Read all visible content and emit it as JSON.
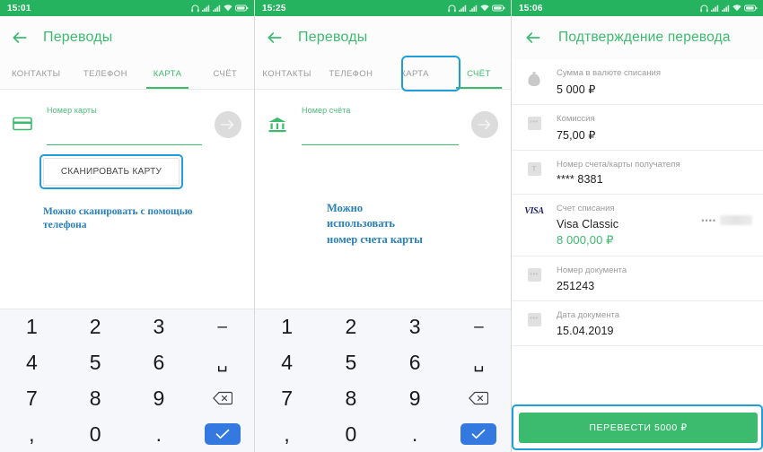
{
  "panels": [
    {
      "id": "transfers-card",
      "statusbar": {
        "time": "15:01",
        "icons": [
          "headphone-icon",
          "signal-icon",
          "signal-icon",
          "wifi-icon",
          "battery-icon"
        ]
      },
      "appbar": {
        "back": "back-arrow-icon",
        "title": "Переводы"
      },
      "tabs": [
        {
          "label": "КОНТАКТЫ",
          "active": false
        },
        {
          "label": "ТЕЛЕФОН",
          "active": false
        },
        {
          "label": "КАРТА",
          "active": true
        },
        {
          "label": "СЧЁТ",
          "active": false
        }
      ],
      "field": {
        "lead_icon": "credit-card-icon",
        "label": "Номер карты",
        "value": "",
        "placeholder": "",
        "submit_icon": "arrow-right-icon"
      },
      "scan_button": "СКАНИРОВАТЬ КАРТУ",
      "note": "Можно сканировать с помощью телефона"
    },
    {
      "id": "transfers-account",
      "statusbar": {
        "time": "15:25",
        "icons": [
          "headphone-icon",
          "signal-icon",
          "signal-icon",
          "wifi-icon",
          "battery-icon"
        ]
      },
      "appbar": {
        "back": "back-arrow-icon",
        "title": "Переводы"
      },
      "tabs": [
        {
          "label": "КОНТАКТЫ",
          "active": false
        },
        {
          "label": "ТЕЛЕФОН",
          "active": false
        },
        {
          "label": "КАРТА",
          "active": false
        },
        {
          "label": "СЧЁТ",
          "active": true
        }
      ],
      "field": {
        "lead_icon": "bank-icon",
        "label": "Номер счёта",
        "value": "",
        "placeholder": "",
        "submit_icon": "arrow-right-icon"
      },
      "note": "Можно использовать номер счета карты"
    }
  ],
  "keypad": {
    "keys": [
      {
        "label": "1",
        "name": "key-1"
      },
      {
        "label": "2",
        "name": "key-2"
      },
      {
        "label": "3",
        "name": "key-3"
      },
      {
        "label": "–",
        "name": "key-dash"
      },
      {
        "label": "4",
        "name": "key-4"
      },
      {
        "label": "5",
        "name": "key-5"
      },
      {
        "label": "6",
        "name": "key-6"
      },
      {
        "label": "␣",
        "name": "key-space"
      },
      {
        "label": "7",
        "name": "key-7"
      },
      {
        "label": "8",
        "name": "key-8"
      },
      {
        "label": "9",
        "name": "key-9"
      },
      {
        "label": "",
        "name": "key-backspace"
      },
      {
        "label": ",",
        "name": "key-comma"
      },
      {
        "label": "0",
        "name": "key-0"
      },
      {
        "label": ".",
        "name": "key-dot"
      },
      {
        "label": "",
        "name": "key-enter"
      }
    ]
  },
  "confirm": {
    "statusbar": {
      "time": "15:06"
    },
    "appbar": {
      "back": "back-arrow-icon",
      "title": "Подтверждение перевода"
    },
    "rows": [
      {
        "icon": "money-bag-icon",
        "label": "Сумма в валюте списания",
        "value": "5 000 ₽",
        "green": false
      },
      {
        "icon": "dots-square-icon",
        "label": "Комиссия",
        "value": "75,00 ₽",
        "green": false
      },
      {
        "icon": "text-square-icon",
        "label": "Номер счета/карты получателя",
        "value": "**** 8381",
        "green": false
      },
      {
        "icon": "visa-icon",
        "label": "Счет списания",
        "value": "Visa Classic",
        "value2": "8 000,00 ₽",
        "green": true,
        "trailing_dots": "••••",
        "trailing_redacted": true
      },
      {
        "icon": "dots-square-icon",
        "label": "Номер документа",
        "value": "251243",
        "green": false
      },
      {
        "icon": "dots-square-icon",
        "label": "Дата документа",
        "value": "15.04.2019",
        "green": false
      }
    ],
    "pay_button": "ПЕРЕВЕСТИ 5000 ₽"
  },
  "colors": {
    "brand_green": "#3cba6e",
    "statusbar_green": "#25b35f",
    "annotation_blue": "#1f9ed9",
    "note_blue": "#2980b9",
    "keypad_bg": "#f5f7fa",
    "enter_blue": "#3479e0"
  }
}
